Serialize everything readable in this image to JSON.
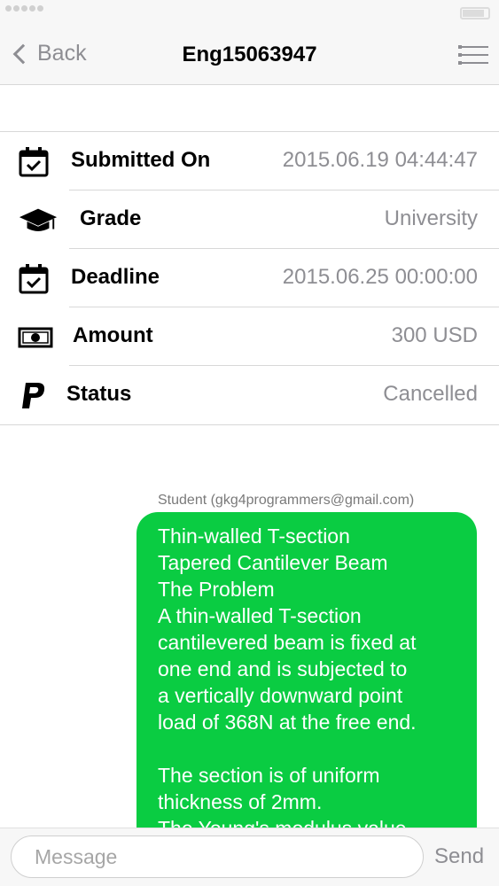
{
  "nav": {
    "back_label": "Back",
    "title": "Eng15063947"
  },
  "details": [
    {
      "icon": "calendar-check-icon",
      "label": "Submitted On",
      "value": "2015.06.19 04:44:47"
    },
    {
      "icon": "graduation-cap-icon",
      "label": "Grade",
      "value": "University"
    },
    {
      "icon": "calendar-check-icon",
      "label": "Deadline",
      "value": "2015.06.25 00:00:00"
    },
    {
      "icon": "banknote-icon",
      "label": "Amount",
      "value": "300 USD"
    },
    {
      "icon": "paypal-icon",
      "label": "Status",
      "value": "Cancelled"
    }
  ],
  "chat": {
    "sender": "Student (gkg4programmers@gmail.com)",
    "message": "Thin-walled T-section\nTapered Cantilever Beam\nThe Problem\nA thin-walled T-section\ncantilevered beam is fixed at\none end and is subjected to\na vertically downward point\nload of 368N at the free end.\n\nThe section is of uniform\nthickness of 2mm.\nThe Young's modulus value"
  },
  "composer": {
    "placeholder": "Message",
    "send_label": "Send"
  },
  "colors": {
    "bubble": "#0acc42",
    "muted_text": "#8e8e93"
  }
}
